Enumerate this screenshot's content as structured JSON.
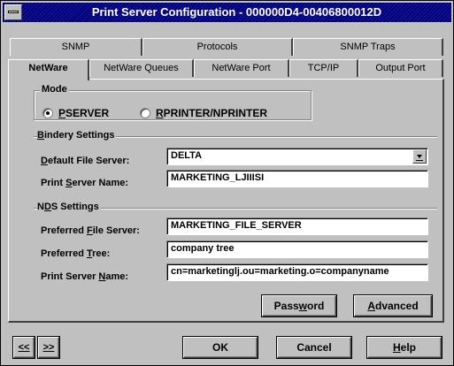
{
  "window": {
    "title": "Print Server Configuration - 000000D4-00406800012D"
  },
  "tabs_back": [
    "SNMP",
    "Protocols",
    "SNMP Traps"
  ],
  "tabs_front": [
    "NetWare",
    "NetWare Queues",
    "NetWare Port",
    "TCP/IP",
    "Output Port"
  ],
  "active_tab": "NetWare",
  "mode": {
    "label": "Mode",
    "options": [
      {
        "pre": "",
        "u": "P",
        "post": "SERVER",
        "selected": true
      },
      {
        "pre": "",
        "u": "R",
        "post": "PRINTER/NPRINTER",
        "selected": false
      }
    ]
  },
  "bindery": {
    "label_u": "B",
    "label_rest": "indery Settings",
    "default_file_server": {
      "pre": "",
      "u": "D",
      "post": "efault File Server:",
      "value": "DELTA"
    },
    "print_server_name": {
      "pre": "Print ",
      "u": "S",
      "post": "erver Name:",
      "value": "MARKETING_LJIIISI"
    }
  },
  "nds": {
    "label_pre": "N",
    "label_u": "D",
    "label_post": "S Settings",
    "preferred_file_server": {
      "pre": "Preferred ",
      "u": "F",
      "post": "ile Server:",
      "value": "MARKETING_FILE_SERVER"
    },
    "preferred_tree": {
      "pre": "Preferred ",
      "u": "T",
      "post": "ree:",
      "value": "company tree"
    },
    "print_server_name": {
      "pre": "Print Server ",
      "u": "N",
      "post": "ame:",
      "value": "cn=marketinglj.ou=marketing.o=companyname"
    }
  },
  "buttons": {
    "password": {
      "pre": "Pass",
      "u": "w",
      "post": "ord"
    },
    "advanced": {
      "pre": "",
      "u": "A",
      "post": "dvanced"
    },
    "ok": "OK",
    "cancel": "Cancel",
    "help": {
      "pre": "",
      "u": "H",
      "post": "elp"
    },
    "prev": {
      "u": "<<"
    },
    "next": {
      "u": ">>"
    }
  },
  "icons": {
    "system_menu": "system-menu-icon",
    "dropdown": "dropdown-arrow-icon"
  }
}
